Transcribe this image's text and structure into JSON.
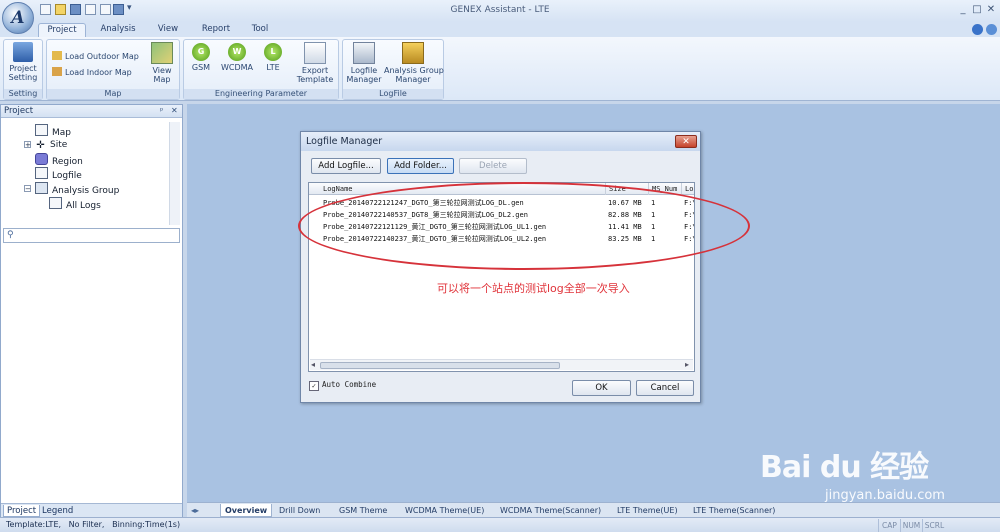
{
  "window": {
    "title": "GENEX Assistant - LTE",
    "logo_letter": "A",
    "controls": {
      "minimize": "_",
      "restore": "□",
      "close": "✕"
    },
    "qat_more": "▾"
  },
  "tabs": [
    "Project",
    "Analysis",
    "View",
    "Report",
    "Tool"
  ],
  "active_tab": "Project",
  "ribbon": {
    "groups": [
      {
        "label": "Setting"
      },
      {
        "label": "Map"
      },
      {
        "label": "Engineering Parameter"
      },
      {
        "label": "LogFile"
      }
    ],
    "project_setting": "Project\nSetting",
    "load_outdoor_map": "Load Outdoor Map",
    "load_indoor_map": "Load Indoor Map",
    "view_map": "View\nMap",
    "gsm": "GSM",
    "gsm_badge": "G",
    "wcdma": "WCDMA",
    "wcdma_badge": "W",
    "lte": "LTE",
    "lte_badge": "L",
    "export_template": "Export\nTemplate",
    "logfile_manager": "Logfile\nManager",
    "analysis_group_manager": "Analysis Group\nManager"
  },
  "left_panel": {
    "title": "Project",
    "pin": "ᵖ",
    "close": "✕",
    "tree": [
      {
        "label": "Map",
        "indent": 1
      },
      {
        "label": "Site",
        "indent": 1,
        "expander": "+"
      },
      {
        "label": "Region",
        "indent": 1
      },
      {
        "label": "Logfile",
        "indent": 1
      },
      {
        "label": "Analysis Group",
        "indent": 1,
        "expander": "−"
      },
      {
        "label": "All Logs",
        "indent": 2
      }
    ],
    "bottom_tabs": [
      "Project",
      "Legend"
    ]
  },
  "dialog": {
    "title": "Logfile Manager",
    "close": "✕",
    "buttons": {
      "add_logfile": "Add Logfile...",
      "add_folder": "Add Folder...",
      "delete": "Delete"
    },
    "columns": [
      "LogName",
      "Size",
      "MS_Num",
      "Lo"
    ],
    "rows": [
      {
        "name": "Probe_20140722121247_DGTO_第三轮拉网测试LOG_DL.gen",
        "size": "10.67 MB",
        "ms": "1",
        "lo": "F:\\"
      },
      {
        "name": "Probe_20140722140537_DGT8_第三轮拉网测试LOG_DL2.gen",
        "size": "82.88 MB",
        "ms": "1",
        "lo": "F:\\"
      },
      {
        "name": "Probe_20140722121129_黄江_DGTO_第三轮拉网测试LOG_UL1.gen",
        "size": "11.41 MB",
        "ms": "1",
        "lo": "F:\\"
      },
      {
        "name": "Probe_20140722140237_黄江_DGTO_第三轮拉网测试LOG_UL2.gen",
        "size": "83.25 MB",
        "ms": "1",
        "lo": "F:\\"
      }
    ],
    "scroll_left": "◂",
    "scroll_right": "▸",
    "auto_combine": "Auto Combine",
    "auto_combine_mark": "✓",
    "ok": "OK",
    "cancel": "Cancel"
  },
  "annotation": "可以将一个站点的测试log全部一次导入",
  "sheet_tabs": [
    "Overview",
    "Drill Down",
    "GSM Theme",
    "WCDMA Theme(UE)",
    "WCDMA Theme(Scanner)",
    "LTE Theme(UE)",
    "LTE Theme(Scanner)"
  ],
  "active_sheet": "Overview",
  "status": {
    "text": "Template:LTE,   No Filter,   Binning:Time(1s)",
    "indicators": [
      "CAP",
      "NUM",
      "SCRL"
    ]
  },
  "watermark": {
    "logo": "Bai du 经验",
    "url": "jingyan.baidu.com"
  },
  "colors": {
    "accent": "#d6323a",
    "workspace": "#a9c2e2",
    "ribbon": "#dce8f7"
  }
}
